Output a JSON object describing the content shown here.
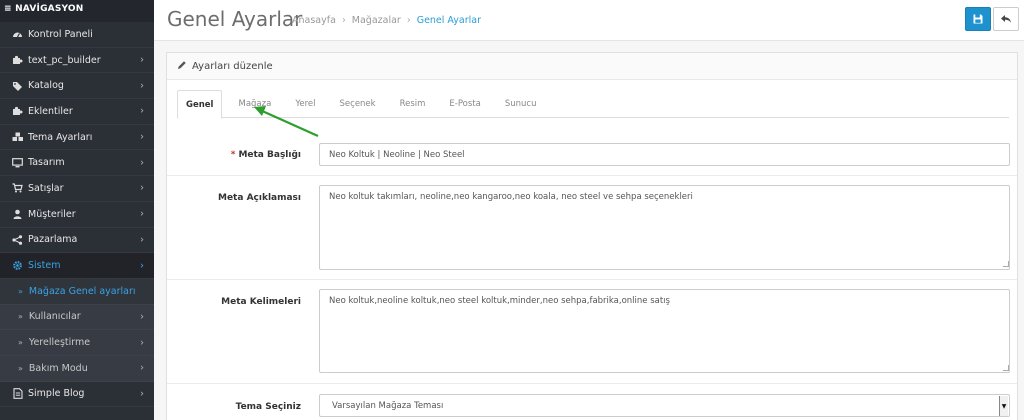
{
  "sidebar": {
    "heading": "≡ NAVİGASYON",
    "items": [
      {
        "label": "Kontrol Paneli",
        "icon": "dashboard-icon",
        "chevron": false
      },
      {
        "label": "text_pc_builder",
        "icon": "puzzle-icon",
        "chevron": true
      },
      {
        "label": "Katalog",
        "icon": "tags-icon",
        "chevron": true
      },
      {
        "label": "Eklentiler",
        "icon": "puzzle-icon",
        "chevron": true
      },
      {
        "label": "Tema Ayarları",
        "icon": "cubes-icon",
        "chevron": true
      },
      {
        "label": "Tasarım",
        "icon": "desktop-icon",
        "chevron": true
      },
      {
        "label": "Satışlar",
        "icon": "cart-icon",
        "chevron": true
      },
      {
        "label": "Müşteriler",
        "icon": "user-icon",
        "chevron": true
      },
      {
        "label": "Pazarlama",
        "icon": "share-icon",
        "chevron": true
      },
      {
        "label": "Sistem",
        "icon": "gear-icon",
        "chevron": true
      }
    ],
    "subitems": [
      {
        "label": "Mağaza Genel ayarları",
        "chevron": false
      },
      {
        "label": "Kullanıcılar",
        "chevron": true
      },
      {
        "label": "Yerelleştirme",
        "chevron": true
      },
      {
        "label": "Bakım Modu",
        "chevron": true
      }
    ],
    "last_item": {
      "label": "Simple Blog",
      "icon": "document-icon"
    }
  },
  "header": {
    "title": "Genel Ayarlar",
    "breadcrumb": [
      "Anasayfa",
      "Mağazalar",
      "Genel Ayarlar"
    ]
  },
  "panel": {
    "title": "Ayarları düzenle"
  },
  "tabs": [
    "Genel",
    "Mağaza",
    "Yerel",
    "Seçenek",
    "Resim",
    "E-Posta",
    "Sunucu"
  ],
  "form": {
    "meta_title_label": "Meta Başlığı",
    "meta_title_value": "Neo Koltuk | Neoline | Neo Steel",
    "meta_desc_label": "Meta Açıklaması",
    "meta_desc_value": "Neo koltuk takımları, neoline,neo kangaroo,neo koala, neo steel ve sehpa seçenekleri",
    "meta_keywords_label": "Meta Kelimeleri",
    "meta_keywords_value": "Neo koltuk,neoline koltuk,neo steel koltuk,minder,neo sehpa,fabrika,online satış",
    "theme_label": "Tema Seçiniz",
    "theme_value": "Varsayılan Mağaza Teması"
  },
  "colors": {
    "sidebar_bg": "#2b2f36",
    "accent": "#3aa3e3",
    "save_button": "#1e91cf",
    "annotation_arrow": "#2e9e2e",
    "required_star": "#c0392b"
  }
}
